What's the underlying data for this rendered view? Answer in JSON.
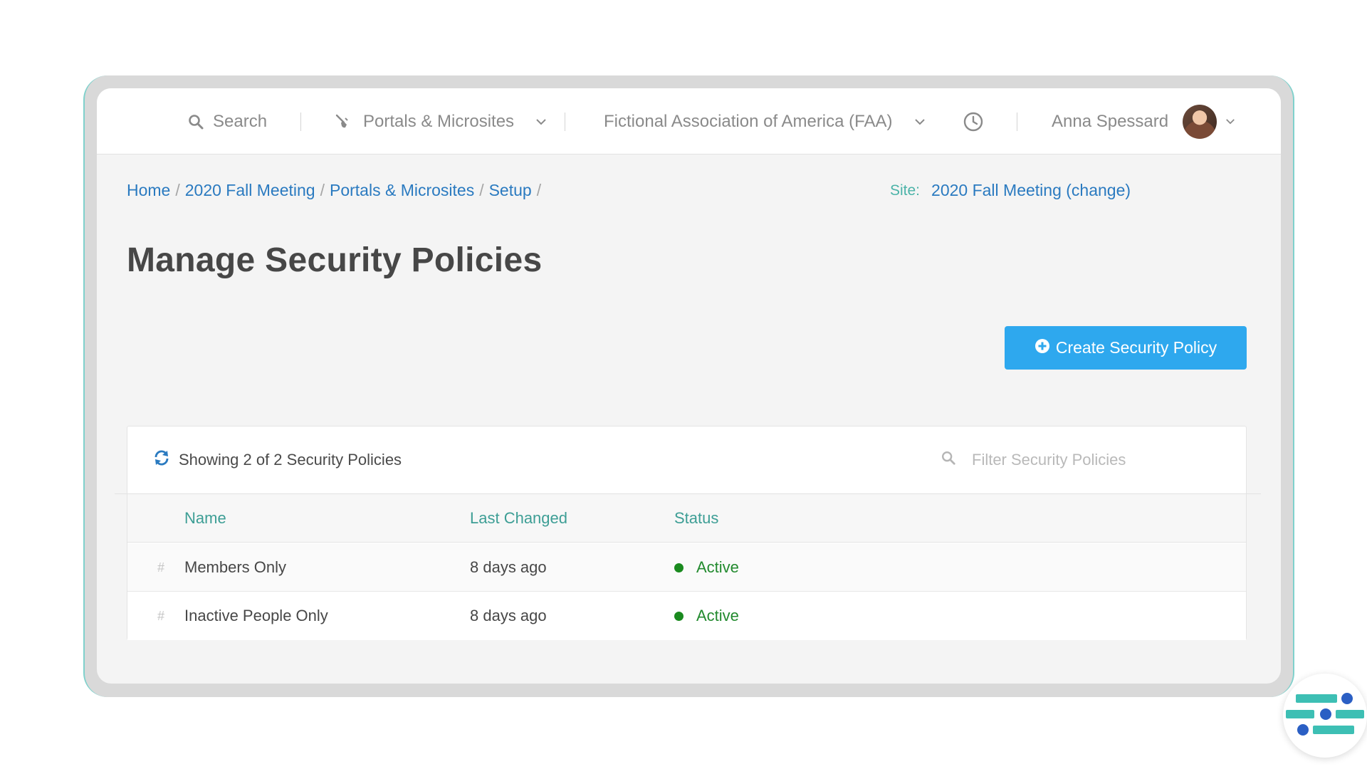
{
  "topbar": {
    "search_label": "Search",
    "module_label": "Portals & Microsites",
    "org_label": "Fictional Association of America (FAA)",
    "user_name": "Anna Spessard"
  },
  "breadcrumb": {
    "items": [
      "Home",
      "2020 Fall Meeting",
      "Portals & Microsites",
      "Setup"
    ]
  },
  "site": {
    "label": "Site:",
    "value": "2020 Fall Meeting (change)"
  },
  "page": {
    "title": "Manage Security Policies",
    "create_button": "Create Security Policy"
  },
  "table": {
    "showing_text": "Showing 2 of 2 Security Policies",
    "filter_placeholder": "Filter Security Policies",
    "columns": [
      "Name",
      "Last Changed",
      "Status"
    ],
    "rows": [
      {
        "hash": "#",
        "name": "Members Only",
        "last_changed": "8 days ago",
        "status": "Active"
      },
      {
        "hash": "#",
        "name": "Inactive People Only",
        "last_changed": "8 days ago",
        "status": "Active"
      }
    ]
  },
  "colors": {
    "accent": "#2ea8ee",
    "link": "#2a7ac0",
    "teal": "#3d9e95",
    "status_active": "#1a8a1f"
  },
  "icons": [
    "search-icon",
    "plug-icon",
    "chevron-down-icon",
    "clock-icon",
    "plus-circle-icon",
    "refresh-icon",
    "help-widget-icon"
  ]
}
